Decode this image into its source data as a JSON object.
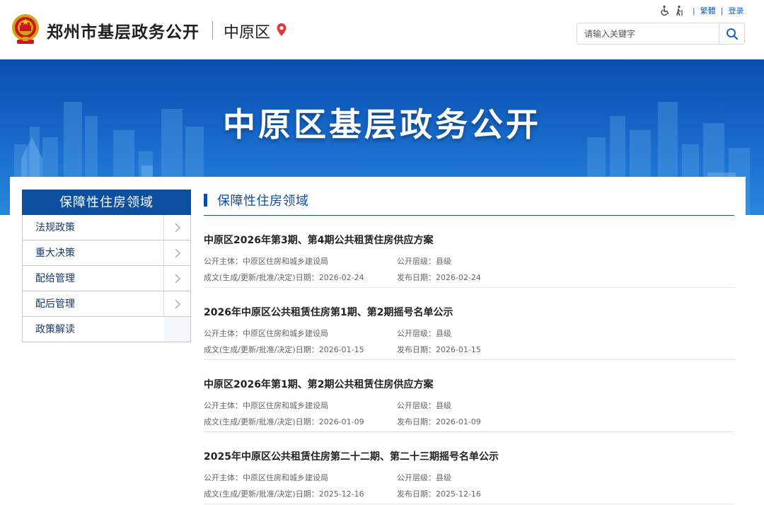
{
  "header": {
    "site_title": "郑州市基层政务公开",
    "district": "中原区",
    "top_links": {
      "traditional": "繁體",
      "login": "登录"
    },
    "search": {
      "placeholder": "请输入关键字"
    },
    "icons": [
      "national-emblem-icon",
      "location-pin-icon",
      "wheelchair-icon",
      "elderly-icon",
      "search-icon"
    ],
    "colors": {
      "pin": "#e0383e",
      "link": "#1b63b8"
    }
  },
  "banner": {
    "title": "中原区基层政务公开"
  },
  "sidebar": {
    "title": "保障性住房领域",
    "items": [
      {
        "label": "法规政策"
      },
      {
        "label": "重大决策"
      },
      {
        "label": "配给管理"
      },
      {
        "label": "配后管理"
      },
      {
        "label": "政策解读"
      }
    ]
  },
  "main": {
    "section_title": "保障性住房领域",
    "articles": [
      {
        "title": "中原区2026年第3期、第4期公共租赁住房供应方案",
        "subject": "公开主体：中原区住房和城乡建设局",
        "level": "公开层级：县级",
        "made_date": "成文(生成/更新/批准/决定)日期：2026-02-24",
        "pub_date": "发布日期：2026-02-24"
      },
      {
        "title": "2026年中原区公共租赁住房第1期、第2期摇号名单公示",
        "subject": "公开主体：中原区住房和城乡建设局",
        "level": "公开层级：县级",
        "made_date": "成文(生成/更新/批准/决定)日期：2026-01-15",
        "pub_date": "发布日期：2026-01-15"
      },
      {
        "title": "中原区2026年第1期、第2期公共租赁住房供应方案",
        "subject": "公开主体：中原区住房和城乡建设局",
        "level": "公开层级：县级",
        "made_date": "成文(生成/更新/批准/决定)日期：2026-01-09",
        "pub_date": "发布日期：2026-01-09"
      },
      {
        "title": "2025年中原区公共租赁住房第二十二期、第二十三期摇号名单公示",
        "subject": "公开主体：中原区住房和城乡建设局",
        "level": "公开层级：县级",
        "made_date": "成文(生成/更新/批准/决定)日期：2025-12-16",
        "pub_date": "发布日期：2025-12-16"
      }
    ]
  }
}
